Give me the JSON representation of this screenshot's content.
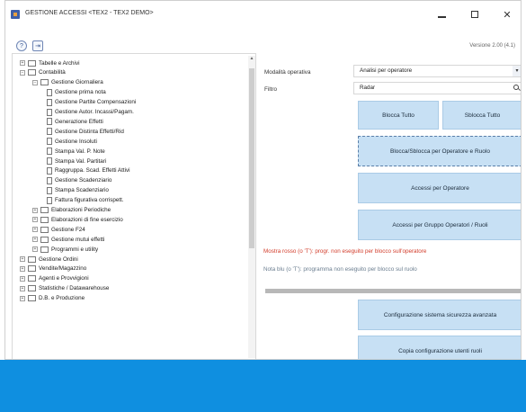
{
  "window": {
    "title": "GESTIONE ACCESSI <TEX2 - TEX2 DEMO>",
    "minimize_label": "",
    "maximize_label": "",
    "close_label": "✕"
  },
  "toolbar": {
    "help_glyph": "?",
    "exit_glyph": "⇥",
    "version": "Versione 2.00 (4.1)"
  },
  "tree": {
    "items": [
      {
        "label": "Tabelle e Archivi",
        "level": 0,
        "kind": "folder",
        "expander": "+"
      },
      {
        "label": "Contabilità",
        "level": 0,
        "kind": "folder",
        "expander": "−"
      },
      {
        "label": "Gestione Giornaliera",
        "level": 1,
        "kind": "folder",
        "expander": "−"
      },
      {
        "label": "Gestione prima nota",
        "level": 2,
        "kind": "doc"
      },
      {
        "label": "Gestione Partite Compensazioni",
        "level": 2,
        "kind": "doc"
      },
      {
        "label": "Gestione Autor. Incassi/Pagam.",
        "level": 2,
        "kind": "doc"
      },
      {
        "label": "Generazione Effetti",
        "level": 2,
        "kind": "doc"
      },
      {
        "label": "Gestione Distinta Effetti/Rid",
        "level": 2,
        "kind": "doc"
      },
      {
        "label": "Gestione Insoluti",
        "level": 2,
        "kind": "doc"
      },
      {
        "label": "Stampa Val. P. Note",
        "level": 2,
        "kind": "doc"
      },
      {
        "label": "Stampa Val. Partitari",
        "level": 2,
        "kind": "doc"
      },
      {
        "label": "Raggruppa. Scad. Effetti Attivi",
        "level": 2,
        "kind": "doc"
      },
      {
        "label": "Gestione Scadenziario",
        "level": 2,
        "kind": "doc"
      },
      {
        "label": "Stampa Scadenziario",
        "level": 2,
        "kind": "doc"
      },
      {
        "label": "Fattura figurativa corrispett.",
        "level": 2,
        "kind": "doc"
      },
      {
        "label": "Elaborazioni Periodiche",
        "level": 1,
        "kind": "folder",
        "expander": "+"
      },
      {
        "label": "Elaborazioni di fine esercizio",
        "level": 1,
        "kind": "folder",
        "expander": "+"
      },
      {
        "label": "Gestione F24",
        "level": 1,
        "kind": "folder",
        "expander": "+"
      },
      {
        "label": "Gestione mutui effetti",
        "level": 1,
        "kind": "folder",
        "expander": "+"
      },
      {
        "label": "Programmi e utility",
        "level": 1,
        "kind": "folder",
        "expander": "+"
      },
      {
        "label": "Gestione Ordini",
        "level": 0,
        "kind": "folder",
        "expander": "+"
      },
      {
        "label": "Vendite/Magazzino",
        "level": 0,
        "kind": "folder",
        "expander": "+"
      },
      {
        "label": "Agenti e Provvigioni",
        "level": 0,
        "kind": "folder",
        "expander": "+"
      },
      {
        "label": "Statistiche / Datawarehouse",
        "level": 0,
        "kind": "folder",
        "expander": "+"
      },
      {
        "label": "D.B. e Produzione",
        "level": 0,
        "kind": "folder",
        "expander": "+"
      }
    ],
    "scroll_up_glyph": "▲"
  },
  "form": {
    "mode_label": "Modalità operativa",
    "mode_value": "Analisi per operatore",
    "filter_label": "Filtro",
    "filter_value": "Radar"
  },
  "buttons": {
    "block_all": "Blocca Tutto",
    "unblock_all": "Sblocca Tutto",
    "block_by_operator": "Blocca/Sblocca per Operatore e Ruolo",
    "access_by_operator": "Accessi per Operatore",
    "access_by_group": "Accessi per Gruppo Operatori / Ruoli",
    "configure_security": "Configurazione sistema sicurezza avanzata",
    "copy_config": "Copia configurazione utenti ruoli"
  },
  "notes": {
    "red": "Mostra rosso (o 'T'): progr. non eseguito per blocco sull'operatore",
    "gray": "Nota blu (o 'T'): programma non eseguito per blocco sul ruolo"
  },
  "progress": {
    "value_percent": 100
  },
  "colors": {
    "accent": "#0f8fe0",
    "button_bg": "#c7e0f4",
    "warning_text": "#d23c2a"
  },
  "icons": {
    "app": "app-icon",
    "help": "help-icon",
    "exit": "exit-icon",
    "folder": "folder-icon",
    "document": "document-icon",
    "search": "search-icon",
    "dropdown": "chevron-down-icon"
  }
}
